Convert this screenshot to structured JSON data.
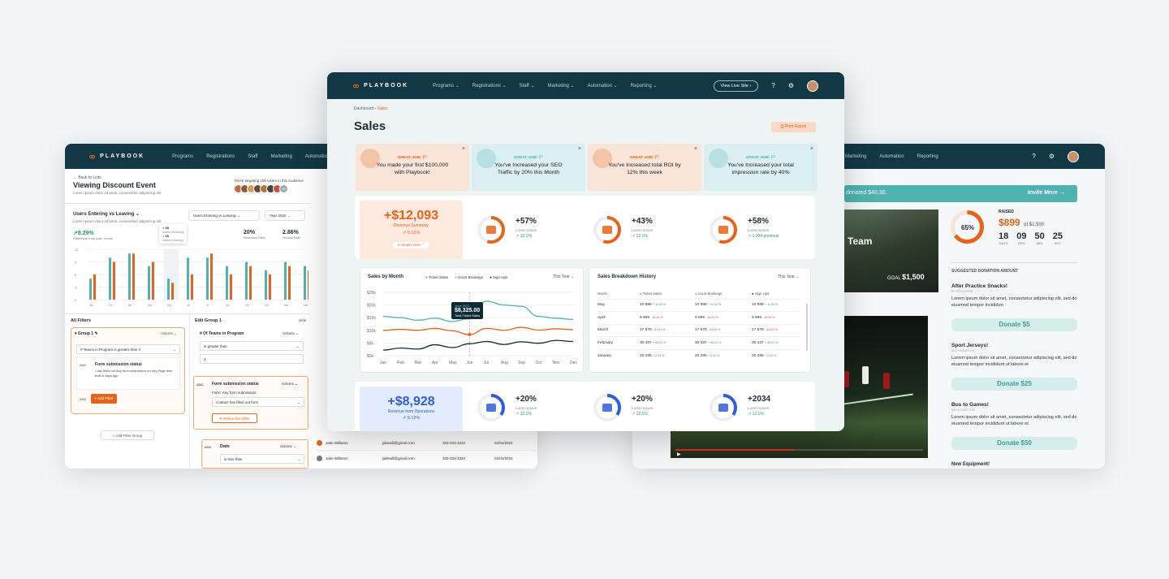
{
  "brand": "PLAYBOOK",
  "nav": {
    "programs": "Programs",
    "registrations": "Registrations",
    "staff": "Staff",
    "marketing": "Marketing",
    "automation": "Automation",
    "reporting": "Reporting",
    "view_live": "View Live Site"
  },
  "left": {
    "back": "← Back to Lists",
    "title": "Viewing Discount Event",
    "subtitle": "Lorem ipsum dolor sit amet, consectetur adipiscing elit",
    "targeting": "You're targeting 150 Users in this Audience",
    "avatar_more": "+50",
    "chart_title": "Users Entering vs Leaving",
    "chart_sub": "Lorem ipsum dolor sit amet, consectetur adipiscing elit",
    "select1": "Users Entering vs Leaving",
    "select2": "Year 2022",
    "stat1_value": "8.29%",
    "stat1_label": "Difference from prev. month",
    "stat2_value": "20%",
    "stat2_label": "Retention Rate",
    "stat3_value": "2.86%",
    "stat3_label": "Growth Rate",
    "tooltip": {
      "a": "85",
      "a_label": "Users Entering",
      "b": "65",
      "b_label": "Users Leaving"
    },
    "yticks": [
      "12",
      "9",
      "6",
      "3",
      "0"
    ],
    "months": [
      "Ja",
      "Fe",
      "Mr",
      "Ap",
      "My",
      "Jn",
      "Jl",
      "Au",
      "Se",
      "Oc",
      "No",
      "De"
    ],
    "all_filters": "All Filters",
    "group1": "Group 1",
    "actions": "Actions",
    "teams_filter": "# Teams in Program is greater than 3",
    "form_status": "Form submission status",
    "form_detail": "• has filled out Any form submission on Any Page less than 5 days ago",
    "and": "AND",
    "add_filter": "+ Add Filter",
    "add_group": "+ Add Filter Group",
    "edit_group": "Edit Group 1",
    "hide": "Hide",
    "num_teams": "# Of Teams in Program",
    "is_greater": "is greater than",
    "three": "3",
    "form_sub2": "Form submission status",
    "form_any": "Form: Any form submission",
    "contact_filled": "Contact has filled out form",
    "refine": "Refine this Filter",
    "date": "Date",
    "is_less": "is less than",
    "rows": [
      {
        "name": "Jake Williams",
        "email": "jakewill@gmail.com",
        "phone": "333-333-3333",
        "date": "01/01/2022"
      },
      {
        "name": "Jake Williams",
        "email": "jakewill@gmail.com",
        "phone": "333-333-3333",
        "date": "01/01/2022"
      }
    ]
  },
  "center": {
    "crumb1": "Dashboard",
    "crumb2": "Sales",
    "title": "Sales",
    "print": "Print Report",
    "alerts": [
      {
        "tag": "GREAT JOB! 🏳",
        "text": "You made your first $100,000 with Playbook!"
      },
      {
        "tag": "GREAT JOB! 🏳",
        "text": "You've Increased your SEO Traffic by 20% this Month"
      },
      {
        "tag": "GREAT JOB! 🏳",
        "text": "You've Increased total ROI by 12% this week"
      },
      {
        "tag": "GREAT JOB! 🏳",
        "text": "You've Increased your total impression rate by 40%"
      }
    ],
    "revenue": {
      "value": "+$12,093",
      "label": "Revenue Summary",
      "change": "↗ 9.12%",
      "depth": "In Depth View ⌃"
    },
    "kpis1": [
      {
        "value": "+57%",
        "label": "Lorem Ipsum",
        "change": "12.1%"
      },
      {
        "value": "+43%",
        "label": "Lorem Ipsum",
        "change": "12.1%"
      },
      {
        "value": "+58%",
        "label": "Lorem Ipsum",
        "change": "1,204 previous"
      }
    ],
    "sales_month": "Sales by Month",
    "legend": [
      "Ticket Sales",
      "Court Bookings",
      "Sign Ups"
    ],
    "this_year": "This Year ⌄",
    "tooltip": {
      "date": "June 2021",
      "value": "$8,325.00",
      "label": "Total Ticket Sales"
    },
    "history_title": "Sales Breakdown History",
    "history_cols": [
      "Month",
      "Ticket Sales",
      "Court Bookings",
      "Sign Ups"
    ],
    "history": [
      {
        "m": "May",
        "a": "10 988",
        "ac": "+ 11.02 %",
        "b": "10 988",
        "bc": "+ 11.02 %",
        "c": "10 988",
        "cc": "+ 11.02 %"
      },
      {
        "m": "April",
        "a": "9 899",
        "ac": "- 44.01 %",
        "b": "9 899",
        "bc": "- 44.01 %",
        "c": "9 899",
        "cc": "- 44.01 %"
      },
      {
        "m": "March",
        "a": "17 678",
        "ac": "- 41.01 %",
        "b": "17 678",
        "bc": "- 41.01 %",
        "c": "17 678",
        "cc": "- 41.01 %"
      },
      {
        "m": "February",
        "a": "30 437",
        "ac": "+ 50.01 %",
        "b": "30 437",
        "bc": "+ 50.01 %",
        "c": "30 437",
        "cc": "+ 50.01 %"
      },
      {
        "m": "January",
        "a": "20 285",
        "ac": "+ 2.31 %",
        "b": "20 285",
        "bc": "+ 2.31 %",
        "c": "20 285",
        "cc": "+ 2.31 %"
      }
    ],
    "ops": {
      "value": "+$8,928",
      "label": "Revenue from Operations",
      "change": "↗ 9.12%"
    },
    "kpis2": [
      {
        "value": "+20%",
        "label": "Lorem Ipsum",
        "change": "12.1%"
      },
      {
        "value": "+20%",
        "label": "Lorem Ipsum",
        "change": "12.1%"
      },
      {
        "value": "+2034",
        "label": "Lorem Ipsum",
        "change": "12.1%"
      }
    ]
  },
  "chart_data": {
    "type": "line",
    "title": "Sales by Month",
    "categories": [
      "Jan",
      "Feb",
      "Mar",
      "Apr",
      "May",
      "Jun",
      "Jul",
      "Aug",
      "Sep",
      "Oct",
      "Nov",
      "Dec"
    ],
    "yticks": [
      "$25k",
      "$20k",
      "$15k",
      "$10k",
      "$5k",
      "$0k"
    ],
    "ylim": [
      0,
      25000
    ],
    "series": [
      {
        "name": "Ticket Sales",
        "color": "#e8631a",
        "values": [
          10000,
          10400,
          10000,
          10800,
          9800,
          8325,
          10800,
          10000,
          11200,
          10100,
          10600,
          10300
        ]
      },
      {
        "name": "Court Bookings",
        "color": "#4fb3b1",
        "values": [
          15500,
          15000,
          14000,
          14800,
          13500,
          14600,
          21500,
          20000,
          19500,
          15500,
          14800,
          14300
        ]
      },
      {
        "name": "Sign Ups",
        "color": "#0d2b36",
        "values": [
          2200,
          3000,
          2600,
          4300,
          3200,
          4700,
          5600,
          4400,
          5500,
          4900,
          6000,
          5600
        ]
      }
    ]
  },
  "right": {
    "banner": "donated $40.30.",
    "invite": "Invite More →",
    "team": "Team",
    "goal_label": "GOAL",
    "goal": "$1,500",
    "percent": "65%",
    "raised_label": "RAISED",
    "raised": "$899",
    "of": "of $1,500",
    "countdown": [
      {
        "v": "18",
        "l": "DAYS"
      },
      {
        "v": "09",
        "l": "HRS"
      },
      {
        "v": "50",
        "l": "MIN"
      },
      {
        "v": "25",
        "l": "SEC"
      }
    ],
    "suggested": "SUGGESTED DONATION AMOUNT",
    "donations": [
      {
        "title": "After Practice Snacks!",
        "sub": "$5 DONATION",
        "desc": "Lorem ipsum dolor sit amet, consectetur adipiscing elit, sed do eiusmod tempor incididun",
        "btn": "Donate $5"
      },
      {
        "title": "Sport Jerseys!",
        "sub": "$25 DONATION",
        "desc": "Lorem ipsum dolor sit amet, consectetur adipiscing elit, sed do eiusmod tempor incididunt ut labore et",
        "btn": "Donate $25"
      },
      {
        "title": "Bus to Games!",
        "sub": "$50 DONATION",
        "desc": "Lorem ipsum dolor sit amet, consectetur adipiscing elit, sed do eiusmod tempor incididunt ut labore et",
        "btn": "Donate $50"
      }
    ],
    "more": "New Equipment!"
  },
  "colors": {
    "navy": "#123845",
    "orange": "#e8631a",
    "teal": "#4fb3b1",
    "blue": "#2e5fd8"
  }
}
